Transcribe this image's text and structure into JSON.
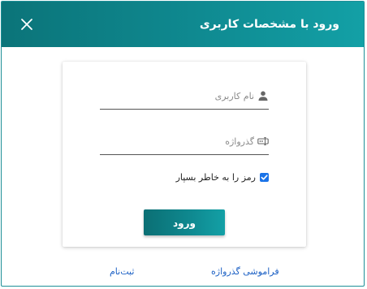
{
  "dialog": {
    "title": "ورود با مشخصات کاربری",
    "close_icon": "close-icon",
    "header_color": "#0f8a91"
  },
  "form": {
    "username": {
      "placeholder": "نام کاربری",
      "value": "",
      "icon": "user-icon"
    },
    "password": {
      "placeholder": "گذرواژه",
      "value": "",
      "icon": "password-icon"
    },
    "remember": {
      "label": "رمز را به خاطر بسپار",
      "checked": true,
      "color": "#1a73e8"
    },
    "submit_label": "ورود"
  },
  "links": {
    "forgot_password": "فراموشی گذرواژه",
    "register": "ثبت‌نام",
    "color": "#1a5fc4"
  }
}
